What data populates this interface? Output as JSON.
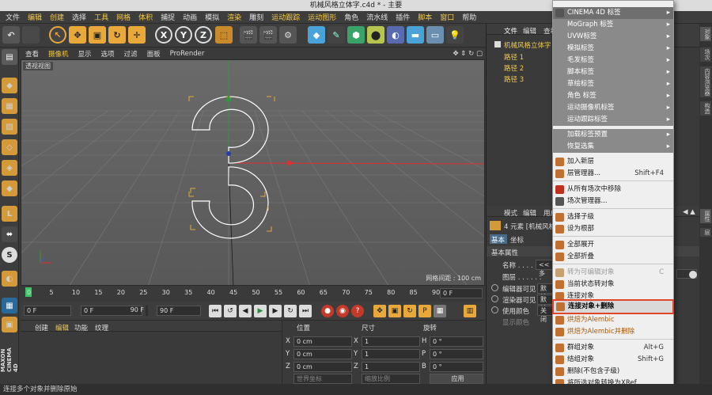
{
  "window": {
    "title": "机械风格立体字.c4d * - 主要"
  },
  "menubar": [
    "文件",
    "编辑",
    "创建",
    "选择",
    "工具",
    "网格",
    "体积",
    "捕捉",
    "动画",
    "模拟",
    "渲染",
    "雕刻",
    "运动跟踪",
    "运动图形",
    "角色",
    "流水线",
    "插件",
    "脚本",
    "窗口",
    "帮助"
  ],
  "toolbar": {
    "x": "X",
    "y": "Y",
    "z": "Z"
  },
  "viewport": {
    "menu": [
      "查看",
      "摄像机",
      "显示",
      "选项",
      "过滤",
      "面板",
      "ProRender"
    ],
    "label": "透视视图",
    "grid": "网格间距 : 100 cm"
  },
  "timeline": {
    "ticks": [
      "0",
      "5",
      "10",
      "15",
      "20",
      "25",
      "30",
      "35",
      "40",
      "45",
      "50",
      "55",
      "60",
      "65",
      "70",
      "75",
      "80",
      "85",
      "90"
    ],
    "current": "0 F"
  },
  "transport": {
    "start": "0 F",
    "cur": "0 F",
    "end": "90 F",
    "end2": "90 F"
  },
  "materials": {
    "tabs": [
      "创建",
      "编辑",
      "功能",
      "纹理"
    ]
  },
  "coords": {
    "headers": [
      "位置",
      "尺寸",
      "旋转"
    ],
    "rows": [
      {
        "axis": "X",
        "pos": "0 cm",
        "size": "1",
        "rot_axis": "H",
        "rot": "0 °"
      },
      {
        "axis": "Y",
        "pos": "0 cm",
        "size": "1",
        "rot_axis": "P",
        "rot": "0 °"
      },
      {
        "axis": "Z",
        "pos": "0 cm",
        "size": "1",
        "rot_axis": "B",
        "rot": "0 °"
      }
    ],
    "mode1": "世界坐标",
    "mode2": "缩放比例",
    "apply": "应用"
  },
  "objmgr": {
    "tabs": [
      "文件",
      "编辑",
      "查看"
    ],
    "root": "机械风格立体字",
    "items": [
      "路径 1",
      "路径 2",
      "路径 3"
    ]
  },
  "attrmgr": {
    "tabs": [
      "模式",
      "编辑",
      "用户"
    ],
    "info": "4 元素 [机械风格...",
    "subtabs": [
      "基本",
      "坐标"
    ],
    "section": "基本属性",
    "name_label": "名称 . . . . . .",
    "name_val": "<<多",
    "layer": "图层 . . . . . .",
    "editor": "编辑器可见",
    "editor_val": "默认",
    "render": "渲染器可见",
    "render_val": "默认",
    "color": "使用颜色",
    "color_val": "关闭",
    "disp": "显示颜色"
  },
  "rightstrip": [
    "对象",
    "场次",
    "内容浏览器",
    "构造"
  ],
  "rightstrip2": [
    "属性",
    "层"
  ],
  "contextmenu": {
    "submenus": [
      "CINEMA 4D 标签",
      "MoGraph 标签",
      "UVW标签",
      "模拟标签",
      "毛发标签",
      "脚本标签",
      "草绘标签",
      "角色 标签",
      "运动摄像机标签",
      "运动跟踪标签"
    ],
    "group2": [
      "加载标签预置",
      "恢复选集"
    ],
    "items": [
      {
        "label": "加入新层",
        "sc": ""
      },
      {
        "label": "层管理器...",
        "sc": "Shift+F4"
      },
      {
        "label": "从所有场次中移除",
        "sc": ""
      },
      {
        "label": "场次管理器...",
        "sc": ""
      },
      {
        "label": "选择子级",
        "sc": ""
      },
      {
        "label": "设为根部",
        "sc": ""
      },
      {
        "label": "全部展开",
        "sc": ""
      },
      {
        "label": "全部折叠",
        "sc": ""
      },
      {
        "label": "转为可编辑对象",
        "sc": "C"
      },
      {
        "label": "当前状态转对象",
        "sc": ""
      },
      {
        "label": "连接对象",
        "sc": ""
      },
      {
        "label": "连接对象+删除",
        "sc": ""
      },
      {
        "label": "烘焙为Alembic",
        "sc": ""
      },
      {
        "label": "烘焙为Alembic并删除",
        "sc": ""
      },
      {
        "label": "群组对象",
        "sc": "Alt+G"
      },
      {
        "label": "结组对象",
        "sc": "Shift+G"
      },
      {
        "label": "删除(不包含子级)",
        "sc": ""
      },
      {
        "label": "将所选对象转换为XRef",
        "sc": ""
      }
    ]
  },
  "status": "连接多个对象并删除原始",
  "brand": "MAXON CINEMA 4D"
}
